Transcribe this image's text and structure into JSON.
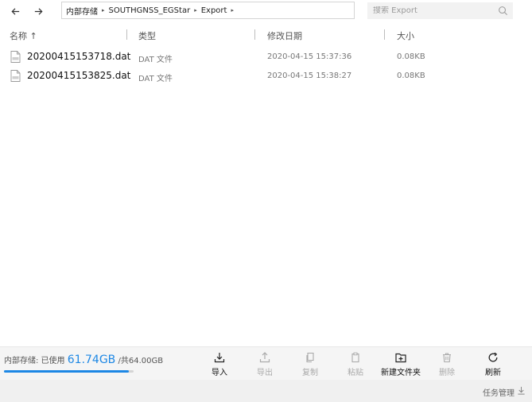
{
  "nav": {
    "back_icon": "arrow-left-icon",
    "forward_icon": "arrow-right-icon"
  },
  "breadcrumb": {
    "items": [
      "内部存储",
      "SOUTHGNSS_EGStar",
      "Export"
    ],
    "separator": "▸"
  },
  "search": {
    "placeholder": "搜索 Export",
    "icon": "search-icon"
  },
  "columns": {
    "name": "名称 ↑",
    "type": "类型",
    "modified": "修改日期",
    "size": "大小"
  },
  "files": [
    {
      "name": "20200415153718.dat",
      "type": "DAT 文件",
      "modified": "2020-04-15 15:37:36",
      "size": "0.08KB",
      "icon": "file-icon"
    },
    {
      "name": "20200415153825.dat",
      "type": "DAT 文件",
      "modified": "2020-04-15 15:38:27",
      "size": "0.08KB",
      "icon": "file-icon"
    }
  ],
  "storage": {
    "label": "内部存储: 已使用",
    "used": "61.74GB",
    "total": "/共64.00GB",
    "used_fraction": 0.9647,
    "accent": "#1e88e5"
  },
  "toolbar": {
    "import": "导入",
    "export": "导出",
    "copy": "复制",
    "paste": "粘贴",
    "new_folder": "新建文件夹",
    "delete": "删除",
    "refresh": "刷新"
  },
  "status": {
    "task_manager": "任务管理"
  }
}
